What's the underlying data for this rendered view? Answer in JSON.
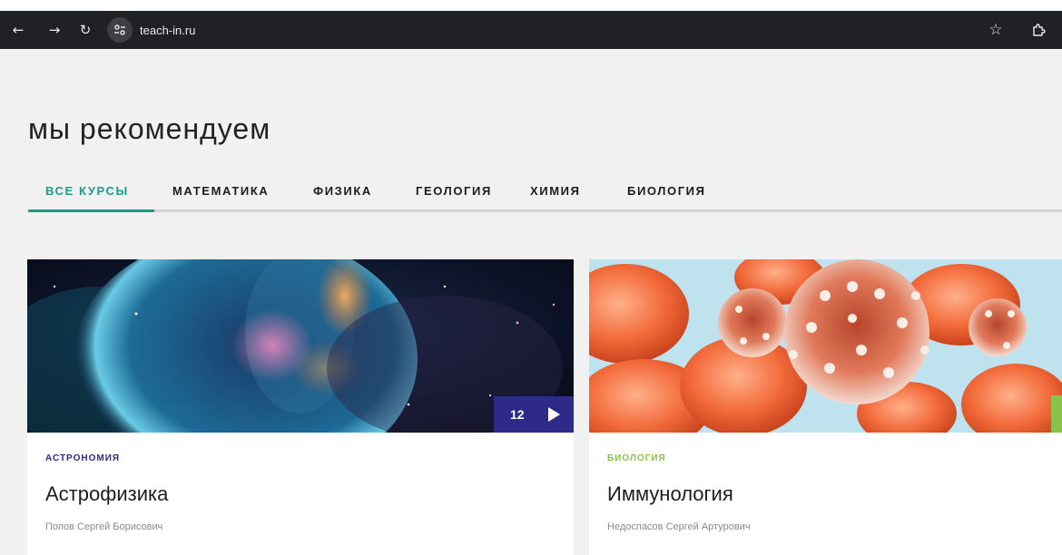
{
  "browser": {
    "url": "teach-in.ru",
    "icons": [
      "back-arrow-icon",
      "forward-arrow-icon",
      "reload-icon",
      "site-info-icon",
      "bookmark-star-icon",
      "extensions-icon"
    ]
  },
  "page": {
    "heading": "мы рекомендуем",
    "tabs": [
      {
        "label": "ВСЕ КУРСЫ",
        "active": true
      },
      {
        "label": "МАТЕМАТИКА",
        "active": false
      },
      {
        "label": "ФИЗИКА",
        "active": false
      },
      {
        "label": "ГЕОЛОГИЯ",
        "active": false
      },
      {
        "label": "ХИМИЯ",
        "active": false
      },
      {
        "label": "БИОЛОГИЯ",
        "active": false
      }
    ],
    "accent_color": "#1a9e8a"
  },
  "courses": [
    {
      "category": "АСТРОНОМИЯ",
      "category_color": "#2e2a8a",
      "title": "Астрофизика",
      "author": "Попов Сергей Борисович",
      "lectures_count": "12",
      "image": "nebula-space-image"
    },
    {
      "category": "БИОЛОГИЯ",
      "category_color": "#8bc34a",
      "title": "Иммунология",
      "author": "Недоспасов Сергей Артурович",
      "image": "blood-cells-image"
    }
  ]
}
